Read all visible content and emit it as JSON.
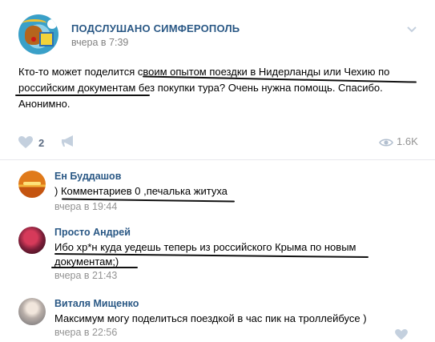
{
  "post": {
    "group_name": "ПОДСЛУШАНО СИМФЕРОПОЛЬ",
    "time": "вчера в 7:39",
    "text": "Кто-то может поделится своим опытом поездки в Нидерланды или Чехию по российским документам без покупки тура? Очень нужна помощь. Спасибо. Анонимно.",
    "likes": "2",
    "views": "1.6K",
    "icons": {
      "options": "chevron-down-icon",
      "like": "heart-icon",
      "share": "megaphone-icon",
      "views": "eye-icon"
    }
  },
  "comments": [
    {
      "author": "Ен Буддашов",
      "text": ") Комментариев 0 ,печалька житуха",
      "time": "вчера в 19:44"
    },
    {
      "author": "Просто Андрей",
      "text": "Ибо хр*н куда уедешь теперь из российского Крыма по новым документам;)",
      "time": "вчера в 21:43"
    },
    {
      "author": "Виталя Мищенко",
      "text": "Максимум могу поделиться поездкой в час пик на троллейбусе )",
      "time": "вчера в 22:56",
      "likes": ""
    }
  ],
  "colors": {
    "link": "#2a5885",
    "meta": "#939393",
    "icon": "#c4d0de",
    "divider": "#e7e8ec",
    "annotation_ink": "#111111"
  }
}
